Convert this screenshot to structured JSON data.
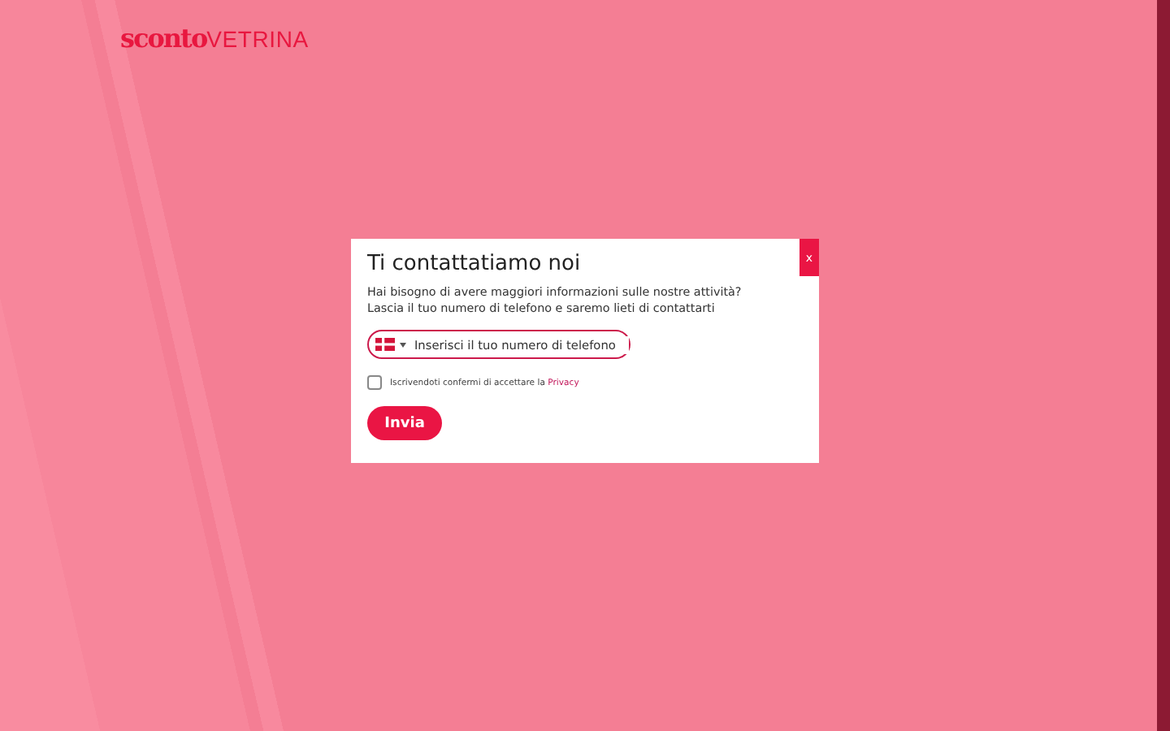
{
  "logo": {
    "part_1": "sconto",
    "part_2": "VETRINA"
  },
  "dialog": {
    "title": "Ti contattatiamo noi",
    "close": "x",
    "lines": [
      "Hai bisogno di avere maggiori informazioni sulle nostre attività?",
      "Lascia il tuo numero di telefono e saremo lieti di contattarti"
    ],
    "phone": {
      "placeholder": "Inserisci il tuo numero di telefono"
    },
    "consent": {
      "text": "Iscrivendoti confermi di accettare la ",
      "link": "Privacy",
      "checked": false
    },
    "submit": "Invia"
  }
}
